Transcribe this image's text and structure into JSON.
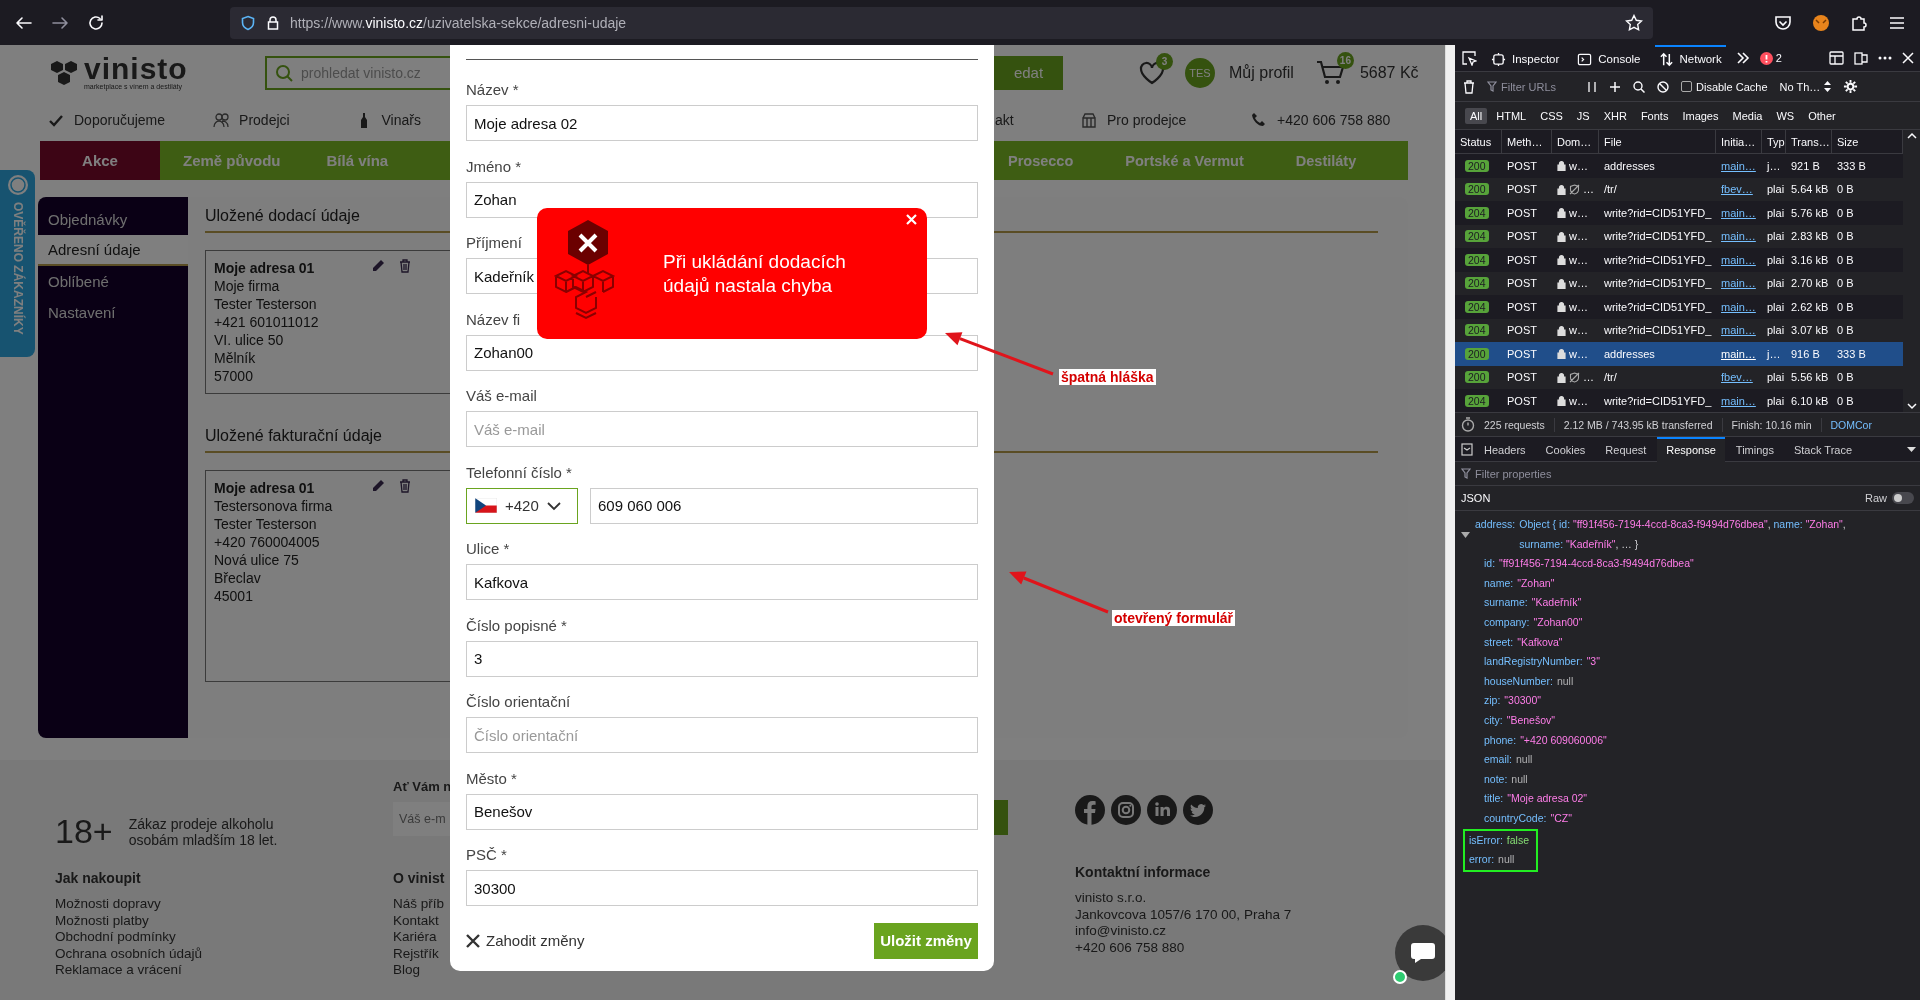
{
  "browser": {
    "url_parts": [
      {
        "text": "https://www.",
        "kind": "dim"
      },
      {
        "text": "vinisto.cz",
        "kind": "host"
      },
      {
        "text": "/uzivatelska-sekce/adresni-udaje",
        "kind": "dim"
      }
    ]
  },
  "site": {
    "logo": {
      "name": "vinisto",
      "tagline": "marketplace s vínem a destiláty"
    },
    "search": {
      "placeholder": "prohledat vinisto.cz",
      "button": "edat"
    },
    "wishlist_count": "3",
    "avatar": "TES",
    "profile": "Můj profil",
    "cart_count": "16",
    "cart_total": "5687 Kč",
    "top_links_left": [
      {
        "label": "Doporučujeme",
        "kind": "check"
      },
      {
        "label": "Prodejci",
        "kind": "people"
      },
      {
        "label": "Vinařs",
        "kind": "bottle"
      }
    ],
    "top_links_right": [
      {
        "label": "akt",
        "kind": "plain"
      },
      {
        "label": "Pro prodejce",
        "kind": "shop"
      },
      {
        "label": "+420 606 758 880",
        "kind": "phone"
      }
    ],
    "nav_left": [
      {
        "label": "Akce",
        "highlighted": true
      },
      {
        "label": "Země původu",
        "highlighted": false
      },
      {
        "label": "Bílá vína",
        "highlighted": false
      }
    ],
    "nav_right": [
      {
        "label": "Prosecco",
        "highlighted": false
      },
      {
        "label": "Portské a Vermut",
        "highlighted": false
      },
      {
        "label": "Destiláty",
        "highlighted": false
      }
    ],
    "verified_badge": "OVĚŘENO ZÁKAZNÍKY",
    "account": {
      "menu": [
        {
          "label": "Objednávky",
          "selected": false
        },
        {
          "label": "Adresní údaje",
          "selected": true
        },
        {
          "label": "Oblíbené",
          "selected": false
        },
        {
          "label": "Nastavení",
          "selected": false
        }
      ],
      "sections": [
        {
          "title": "Uložené dodací údaje",
          "cards": [
            {
              "title": "Moje adresa 01",
              "lines": [
                "Moje firma",
                "Tester Testerson",
                "+421 601011012",
                "VI. ulice 50",
                "Mělník",
                "57000"
              ]
            }
          ]
        },
        {
          "title": "Uložené fakturační údaje",
          "cards": [
            {
              "title": "Moje adresa 01",
              "lines": [
                "Testersonova firma",
                "Tester Testerson",
                "+420 760004005",
                "Nová ulice 75",
                "Břeclav",
                "45001"
              ]
            }
          ]
        }
      ]
    },
    "footer": {
      "age": "18+",
      "age_text": "Zákaz prodeje alkoholu osobám mladším 18 let.",
      "newsletter": {
        "title": "Ať Vám n",
        "placeholder": "Váš e-m"
      },
      "columns": [
        {
          "title": "Jak nakoupit",
          "links": [
            "Možnosti dopravy",
            "Možnosti platby",
            "Obchodní podmínky",
            "Ochrana osobních údajů",
            "Reklamace a vrácení"
          ]
        },
        {
          "title": "O vinist",
          "links": [
            "Náš příb",
            "Kontakt",
            "Kariéra",
            "Rejstřík",
            "Blog"
          ]
        }
      ],
      "social": [
        {
          "kind": "facebook"
        },
        {
          "kind": "instagram"
        },
        {
          "kind": "linkedin"
        },
        {
          "kind": "twitter"
        }
      ],
      "contact": {
        "title": "Kontaktní informace",
        "lines": [
          "vinisto s.r.o.",
          "Jankovcova 1057/6 170 00, Praha 7",
          "info@vinisto.cz",
          "+420 606 758 880"
        ]
      }
    }
  },
  "modal": {
    "fields": [
      {
        "label": "Název *",
        "kind": "text",
        "value": "Moje adresa 02"
      },
      {
        "label": "Jméno *",
        "kind": "text",
        "value": "Zohan"
      },
      {
        "label": "Příjmení",
        "kind": "text",
        "value": "Kadeřník"
      },
      {
        "label": "Název fi",
        "kind": "text",
        "value": "Zohan00"
      },
      {
        "label": "Váš e-mail",
        "kind": "text",
        "placeholder": "Váš e-mail"
      },
      {
        "label": "Telefonní číslo *",
        "kind": "phone",
        "code": "+420",
        "value": "609 060 006"
      },
      {
        "label": "Ulice *",
        "kind": "text",
        "value": "Kafkova"
      },
      {
        "label": "Číslo popisné *",
        "kind": "text",
        "value": "3"
      },
      {
        "label": "Číslo orientační",
        "kind": "text",
        "placeholder": "Číslo orientační"
      },
      {
        "label": "Město *",
        "kind": "text",
        "value": "Benešov"
      },
      {
        "label": "PSČ *",
        "kind": "text",
        "value": "30300"
      }
    ],
    "discard": "Zahodit změny",
    "save": "Uložit změny"
  },
  "toast": {
    "message": "Při ukládání dodacích údajů nastala chyba"
  },
  "annotations": [
    {
      "text": "špatná hláška"
    },
    {
      "text": "otevřený formulář"
    }
  ],
  "devtools": {
    "tabs": [
      {
        "label": "Inspector",
        "kind": "inspector",
        "selected": false
      },
      {
        "label": "Console",
        "kind": "console",
        "selected": false
      },
      {
        "label": "Network",
        "kind": "network",
        "selected": true
      }
    ],
    "error_count": "2",
    "filter_placeholder": "Filter URLs",
    "disable_cache": {
      "label": "Disable Cache",
      "checked": false
    },
    "throttle": "No Th…",
    "type_filters": [
      {
        "label": "All",
        "selected": true
      },
      {
        "label": "HTML",
        "selected": false
      },
      {
        "label": "CSS",
        "selected": false
      },
      {
        "label": "JS",
        "selected": false
      },
      {
        "label": "XHR",
        "selected": false
      },
      {
        "label": "Fonts",
        "selected": false
      },
      {
        "label": "Images",
        "selected": false
      },
      {
        "label": "Media",
        "selected": false
      },
      {
        "label": "WS",
        "selected": false
      },
      {
        "label": "Other",
        "selected": false
      }
    ],
    "columns": [
      "Status",
      "Meth…",
      "Dom…",
      "File",
      "Initia…",
      "Typ",
      "Trans…",
      "Size"
    ],
    "requests": [
      {
        "status": "200",
        "method": "POST",
        "domain": "w…",
        "tracker": false,
        "file": "addresses",
        "initiator": "main…",
        "type": "j…",
        "transferred": "921 B",
        "size": "333 B",
        "selected": false
      },
      {
        "status": "200",
        "method": "POST",
        "domain": "…",
        "tracker": true,
        "file": "/tr/",
        "initiator": "fbev…",
        "type": "plai",
        "transferred": "5.64 kB",
        "size": "0 B",
        "selected": false
      },
      {
        "status": "204",
        "method": "POST",
        "domain": "w…",
        "tracker": false,
        "file": "write?rid=CID51YFD_",
        "initiator": "main…",
        "type": "plai",
        "transferred": "5.76 kB",
        "size": "0 B",
        "selected": false
      },
      {
        "status": "204",
        "method": "POST",
        "domain": "w…",
        "tracker": false,
        "file": "write?rid=CID51YFD_",
        "initiator": "main…",
        "type": "plai",
        "transferred": "2.83 kB",
        "size": "0 B",
        "selected": false
      },
      {
        "status": "204",
        "method": "POST",
        "domain": "w…",
        "tracker": false,
        "file": "write?rid=CID51YFD_",
        "initiator": "main…",
        "type": "plai",
        "transferred": "3.16 kB",
        "size": "0 B",
        "selected": false
      },
      {
        "status": "204",
        "method": "POST",
        "domain": "w…",
        "tracker": false,
        "file": "write?rid=CID51YFD_",
        "initiator": "main…",
        "type": "plai",
        "transferred": "2.70 kB",
        "size": "0 B",
        "selected": false
      },
      {
        "status": "204",
        "method": "POST",
        "domain": "w…",
        "tracker": false,
        "file": "write?rid=CID51YFD_",
        "initiator": "main…",
        "type": "plai",
        "transferred": "2.62 kB",
        "size": "0 B",
        "selected": false
      },
      {
        "status": "204",
        "method": "POST",
        "domain": "w…",
        "tracker": false,
        "file": "write?rid=CID51YFD_",
        "initiator": "main…",
        "type": "plai",
        "transferred": "3.07 kB",
        "size": "0 B",
        "selected": false
      },
      {
        "status": "200",
        "method": "POST",
        "domain": "w…",
        "tracker": false,
        "file": "addresses",
        "initiator": "main…",
        "type": "j…",
        "transferred": "916 B",
        "size": "333 B",
        "selected": true
      },
      {
        "status": "200",
        "method": "POST",
        "domain": "…",
        "tracker": true,
        "file": "/tr/",
        "initiator": "fbev…",
        "type": "plai",
        "transferred": "5.56 kB",
        "size": "0 B",
        "selected": false
      },
      {
        "status": "204",
        "method": "POST",
        "domain": "w…",
        "tracker": false,
        "file": "write?rid=CID51YFD_",
        "initiator": "main…",
        "type": "plai",
        "transferred": "6.10 kB",
        "size": "0 B",
        "selected": false
      }
    ],
    "summary": [
      "225 requests",
      "2.12 MB / 743.95 kB transferred",
      "Finish: 10.16 min",
      "DOMCor"
    ],
    "detail_tabs": [
      {
        "label": "Headers",
        "selected": false
      },
      {
        "label": "Cookies",
        "selected": false
      },
      {
        "label": "Request",
        "selected": false
      },
      {
        "label": "Response",
        "selected": true
      },
      {
        "label": "Timings",
        "selected": false
      },
      {
        "label": "Stack Trace",
        "selected": false
      }
    ],
    "filter_properties_placeholder": "Filter properties",
    "view_label": "JSON",
    "raw": {
      "label": "Raw",
      "on": false
    },
    "tree": [
      {
        "key": "address:",
        "expanded": true,
        "highlighted": false,
        "preview": [
          {
            "text": "Object { ",
            "kind": "key"
          },
          {
            "text": "id: ",
            "kind": "key"
          },
          {
            "text": "\"ff91f456-7194-4ccd-8ca3-f9494d76dbea\"",
            "kind": "string"
          },
          {
            "text": ", ",
            "kind": "punct"
          },
          {
            "text": "name: ",
            "kind": "key"
          },
          {
            "text": "\"Zohan\"",
            "kind": "string"
          },
          {
            "text": ", ",
            "kind": "punct"
          },
          {
            "text": "surname: ",
            "kind": "key"
          },
          {
            "text": "\"Kadeřník\"",
            "kind": "string"
          },
          {
            "text": ", … }",
            "kind": "punct"
          }
        ],
        "children": [
          {
            "key": "id:",
            "value": "\"ff91f456-7194-4ccd-8ca3-f9494d76dbea\"",
            "kind": "string"
          },
          {
            "key": "name:",
            "value": "\"Zohan\"",
            "kind": "string"
          },
          {
            "key": "surname:",
            "value": "\"Kadeřník\"",
            "kind": "string"
          },
          {
            "key": "company:",
            "value": "\"Zohan00\"",
            "kind": "string"
          },
          {
            "key": "street:",
            "value": "\"Kafkova\"",
            "kind": "string"
          },
          {
            "key": "landRegistryNumber:",
            "value": "\"3\"",
            "kind": "string"
          },
          {
            "key": "houseNumber:",
            "value": "null",
            "kind": "null"
          },
          {
            "key": "zip:",
            "value": "\"30300\"",
            "kind": "string"
          },
          {
            "key": "city:",
            "value": "\"Benešov\"",
            "kind": "string"
          },
          {
            "key": "phone:",
            "value": "\"+420 609060006\"",
            "kind": "string"
          },
          {
            "key": "email:",
            "value": "null",
            "kind": "null"
          },
          {
            "key": "note:",
            "value": "null",
            "kind": "null"
          },
          {
            "key": "title:",
            "value": "\"Moje adresa 02\"",
            "kind": "string"
          },
          {
            "key": "countryCode:",
            "value": "\"CZ\"",
            "kind": "string"
          }
        ]
      },
      {
        "key": "isError:",
        "value": "false",
        "kind": "bool",
        "highlighted": true
      },
      {
        "key": "error:",
        "value": "null",
        "kind": "null",
        "highlighted": true
      }
    ]
  }
}
